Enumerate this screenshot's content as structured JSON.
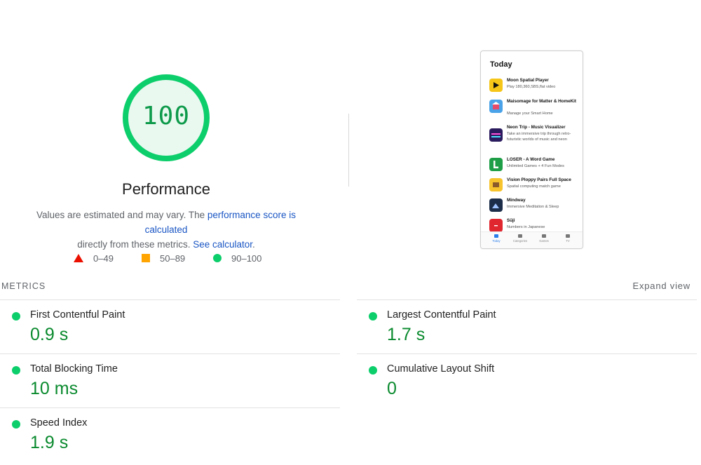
{
  "gauge": {
    "score": "100",
    "title": "Performance",
    "score_fraction": 1.0,
    "color": "#0cce6b"
  },
  "description": {
    "text1": "Values are estimated and may vary. The ",
    "link1": "performance score is calculated",
    "text2": "directly from these metrics. ",
    "link2": "See calculator",
    "text3": "."
  },
  "legend": [
    {
      "shape": "triangle",
      "range": "0–49",
      "color": "#eb0f00"
    },
    {
      "shape": "square",
      "range": "50–89",
      "color": "#ffa400"
    },
    {
      "shape": "circle",
      "range": "90–100",
      "color": "#0cce6b"
    }
  ],
  "screenshot": {
    "title": "Today",
    "apps": [
      {
        "name": "Moon Spatial Player",
        "subtitle": "Play 180,360,SBS,flat video",
        "icon": "play-icon",
        "color": "#f5c518"
      },
      {
        "name": "Maisomage for Matter & HomeKit",
        "subtitle": "Manage your Smart Home",
        "icon": "home-icon",
        "color": "#4aa3e8"
      },
      {
        "name": "Neon Trip - Music Visualizer",
        "subtitle": "Take an immersive trip through retro-futuristic worlds of music and neon",
        "icon": "neon-icon",
        "color": "#2a1a5e"
      },
      {
        "name": "LOSER - A Word Game",
        "subtitle": "Unlimited Games + 4 Fun Modes",
        "icon": "letter-l-icon",
        "color": "#1e9e46"
      },
      {
        "name": "Vision Ploppy Pairs Full Space",
        "subtitle": "Spatial computing match game",
        "icon": "cards-icon",
        "color": "#f7c42d"
      },
      {
        "name": "Mindway",
        "subtitle": "Immersive Meditation & Sleep",
        "icon": "mountain-icon",
        "color": "#1c2d4a"
      },
      {
        "name": "Sūji",
        "subtitle": "Numbers in Japanese",
        "icon": "suji-icon",
        "color": "#e0262f"
      }
    ],
    "tabs": [
      {
        "label": "Today",
        "icon": "today-icon"
      },
      {
        "label": "Categories",
        "icon": "categories-icon"
      },
      {
        "label": "Games",
        "icon": "games-icon"
      },
      {
        "label": "TV",
        "icon": "tv-icon"
      }
    ]
  },
  "metrics_section": {
    "header": "METRICS",
    "expand_label": "Expand view",
    "items": [
      {
        "title": "First Contentful Paint",
        "value": "0.9 s",
        "status": "pass"
      },
      {
        "title": "Largest Contentful Paint",
        "value": "1.7 s",
        "status": "pass"
      },
      {
        "title": "Total Blocking Time",
        "value": "10 ms",
        "status": "pass"
      },
      {
        "title": "Cumulative Layout Shift",
        "value": "0",
        "status": "pass"
      },
      {
        "title": "Speed Index",
        "value": "1.9 s",
        "status": "pass"
      }
    ]
  }
}
